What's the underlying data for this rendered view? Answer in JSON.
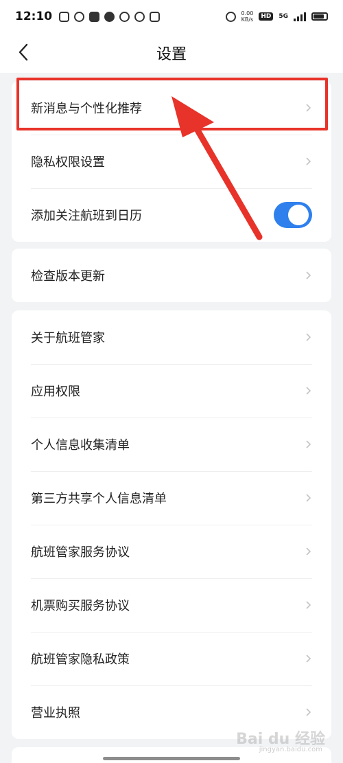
{
  "status_bar": {
    "time": "12:10",
    "net_speed_value": "0.00",
    "net_speed_unit": "KB/s",
    "hd_label": "HD",
    "network_label": "5G"
  },
  "header": {
    "title": "设置"
  },
  "group1": [
    {
      "label": "新消息与个性化推荐"
    },
    {
      "label": "隐私权限设置"
    },
    {
      "label": "添加关注航班到日历",
      "toggle_on": true
    }
  ],
  "group2": [
    {
      "label": "检查版本更新"
    }
  ],
  "group3": [
    {
      "label": "关于航班管家"
    },
    {
      "label": "应用权限"
    },
    {
      "label": "个人信息收集清单"
    },
    {
      "label": "第三方共享个人信息清单"
    },
    {
      "label": "航班管家服务协议"
    },
    {
      "label": "机票购买服务协议"
    },
    {
      "label": "航班管家隐私政策"
    },
    {
      "label": "营业执照"
    }
  ],
  "colors": {
    "accent": "#2f80ed",
    "annotation": "#e8332a",
    "background": "#f2f3f5"
  },
  "watermark": {
    "text": "Bai du 经验",
    "sub": "jingyan.baidu.com"
  }
}
